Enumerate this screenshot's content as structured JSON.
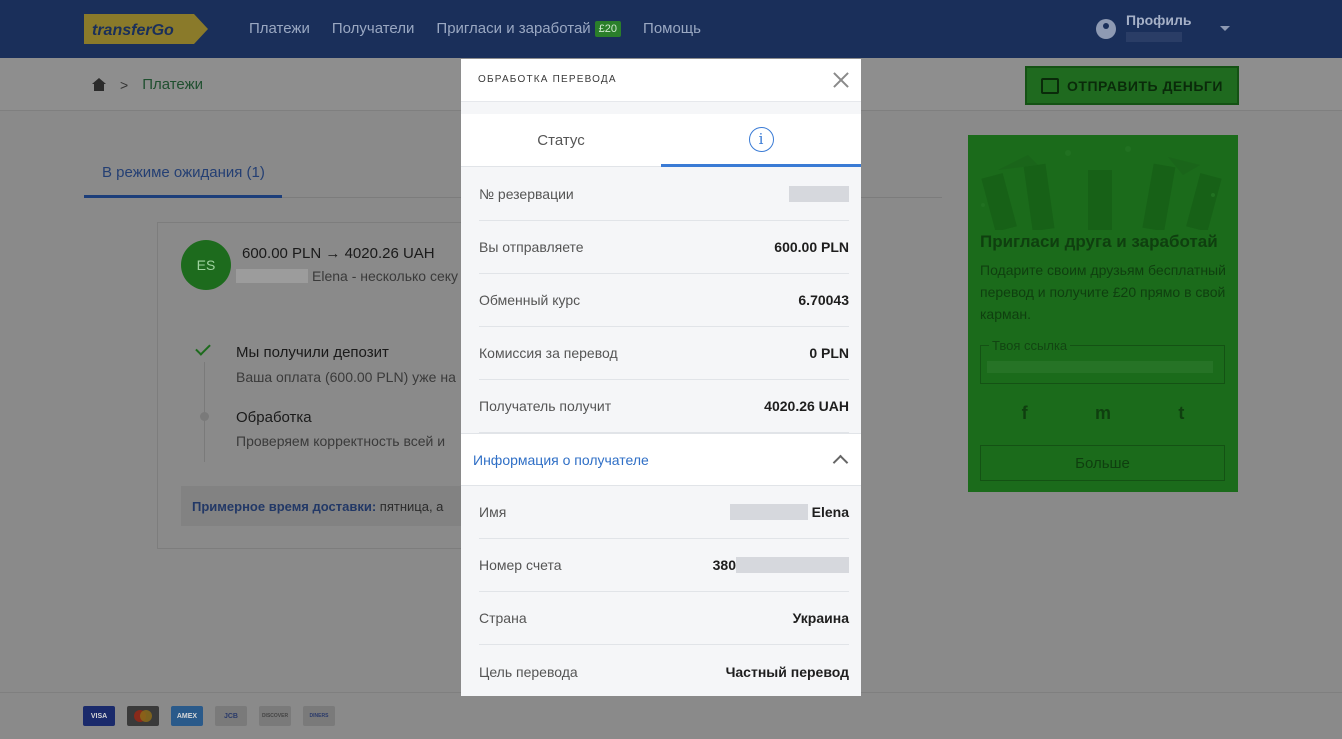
{
  "header": {
    "logo_text": "transferGo",
    "nav": [
      {
        "label": "Платежи"
      },
      {
        "label": "Получатели"
      },
      {
        "label": "Пригласи и заработай",
        "badge": "£20"
      },
      {
        "label": "Помощь"
      }
    ],
    "profile_label": "Профиль"
  },
  "breadcrumb": {
    "current": "Платежи"
  },
  "send_button": "ОТПРАВИТЬ ДЕНЬГИ",
  "tabs": {
    "pending": "В режиме ожидания (1)"
  },
  "transfer": {
    "initials": "ES",
    "amount_from": "600.00 PLN",
    "arrow": "→",
    "amount_to": "4020.26 UAH",
    "recipient_time": "Elena - несколько секу",
    "steps": [
      {
        "title": "Мы получили депозит",
        "desc": "Ваша оплата (600.00 PLN) уже на"
      },
      {
        "title": "Обработка",
        "desc": "Проверяем корректность всей и"
      }
    ],
    "delivery_label": "Примерное время доставки:",
    "delivery_value": "пятница, а"
  },
  "referral": {
    "title": "Пригласи друга и заработай",
    "text": "Подарите своим друзьям бесплатный перевод и получите £20 прямо в свой карман.",
    "link_label": "Твоя ссылка",
    "social": [
      "f",
      "m",
      "t"
    ],
    "more": "Больше"
  },
  "payment_methods": [
    "VISA",
    "MC",
    "AMEX",
    "JCB",
    "DISCOVER",
    "DINERS"
  ],
  "modal": {
    "title": "ОБРАБОТКА ПЕРЕВОДА",
    "tab_status": "Статус",
    "tab_info_icon": "i",
    "rows": [
      {
        "label": "№ резервации",
        "value": ""
      },
      {
        "label": "Вы отправляете",
        "value": "600.00 PLN"
      },
      {
        "label": "Обменный курс",
        "value": "6.70043"
      },
      {
        "label": "Комиссия за перевод",
        "value": "0 PLN"
      },
      {
        "label": "Получатель получит",
        "value": "4020.26 UAH"
      }
    ],
    "recipient_section": "Информация о получателе",
    "recipient_rows": [
      {
        "label": "Имя",
        "value": "Elena"
      },
      {
        "label": "Номер счета",
        "value": "380"
      },
      {
        "label": "Страна",
        "value": "Украина"
      },
      {
        "label": "Цель перевода",
        "value": "Частный перевод"
      }
    ]
  },
  "colors": {
    "header_bg": "#1a2f5a",
    "overlay_bg": "#8a8a8a",
    "accent_blue": "#3a7bd5",
    "brand_green": "#1b6b1b"
  }
}
